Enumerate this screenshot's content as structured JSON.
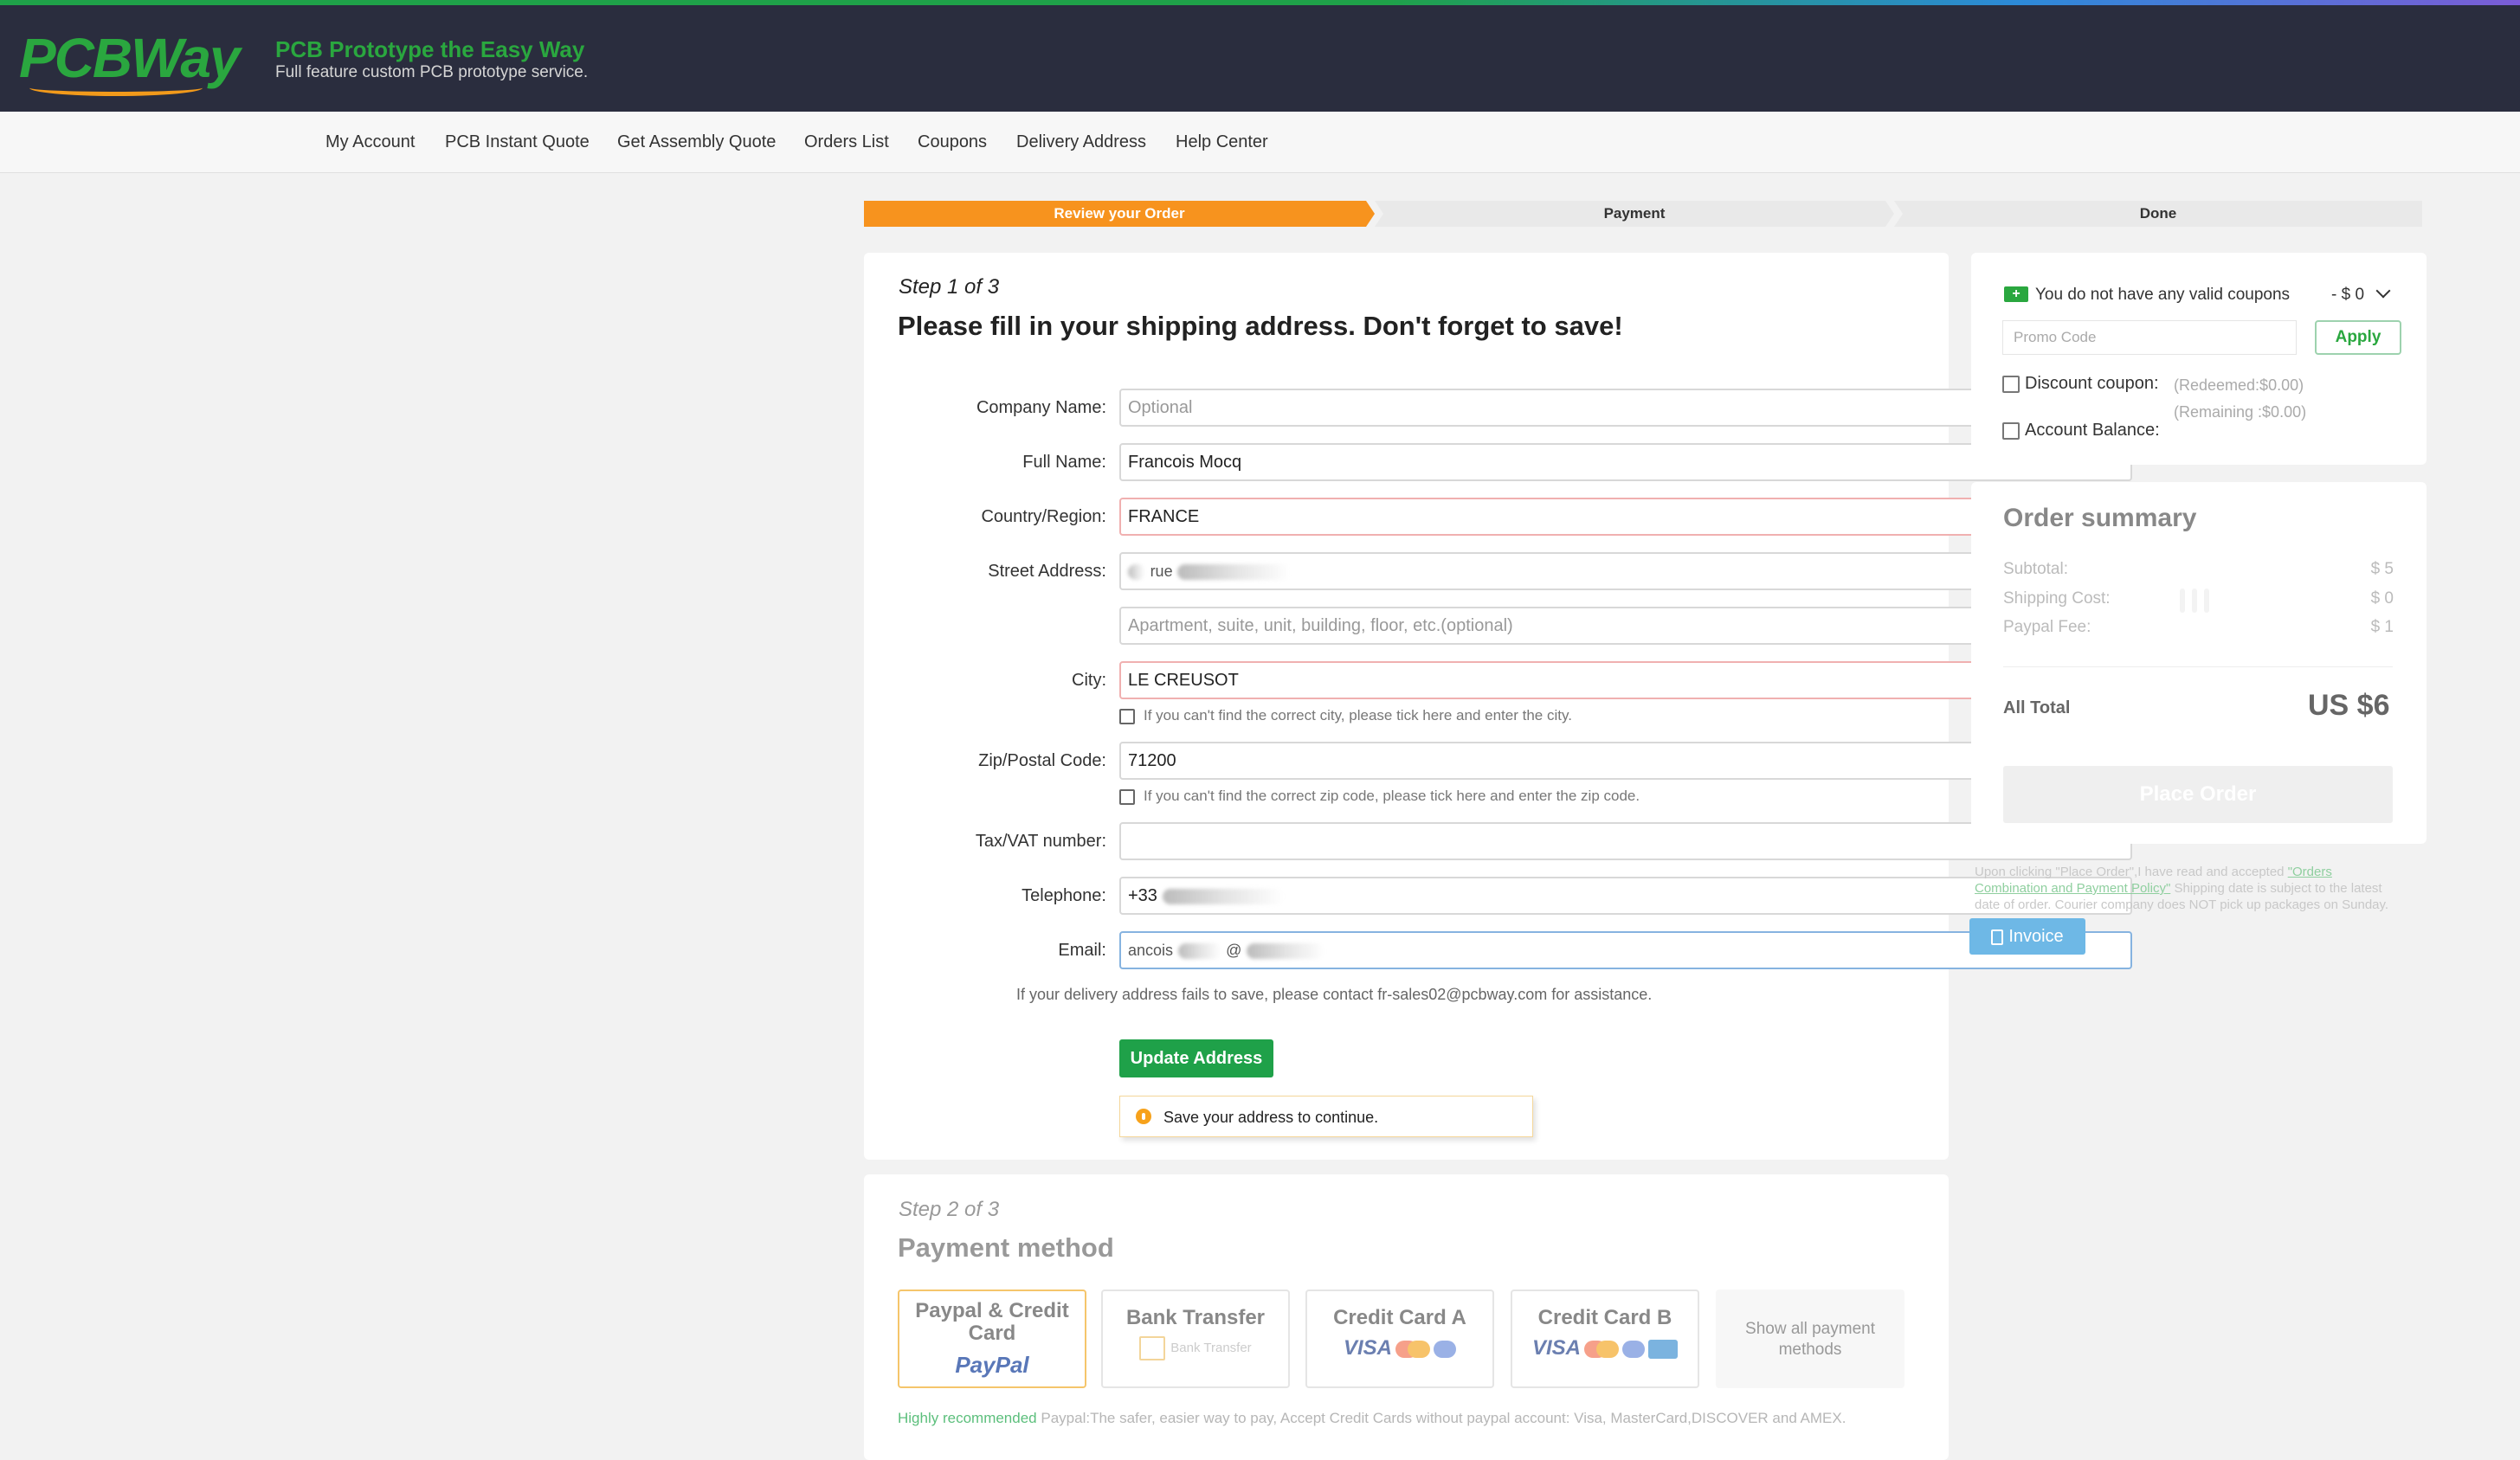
{
  "header": {
    "logo_text": "PCBWay",
    "tagline_title": "PCB Prototype the Easy Way",
    "tagline_sub": "Full feature custom PCB prototype service."
  },
  "nav": {
    "items": [
      "My Account",
      "PCB Instant Quote",
      "Get Assembly Quote",
      "Orders List",
      "Coupons",
      "Delivery Address",
      "Help Center"
    ]
  },
  "progress": {
    "steps": [
      "Review your Order",
      "Payment",
      "Done"
    ],
    "active": "Review your Order"
  },
  "step1": {
    "step_label": "Step 1 of 3",
    "title": "Please fill in your shipping address. Don't forget to save!",
    "labels": {
      "company": "Company Name:",
      "full_name": "Full Name:",
      "country": "Country/Region:",
      "street": "Street Address:",
      "city": "City:",
      "zip": "Zip/Postal Code:",
      "tax": "Tax/VAT number:",
      "telephone": "Telephone:",
      "email": "Email:"
    },
    "values": {
      "company_placeholder": "Optional",
      "full_name": "Francois Mocq",
      "country": "FRANCE",
      "street_visible": "rue",
      "street2_placeholder": "Apartment, suite, unit, building, floor, etc.(optional)",
      "city": "LE CREUSOT",
      "zip": "71200",
      "tax": "",
      "telephone_prefix": "+33",
      "email_visible_a": "ancois",
      "email_visible_b": "@"
    },
    "city_check": "If you can't find the correct city, please tick here and enter the city.",
    "zip_check": "If you can't find the correct zip code, please tick here and enter the zip code.",
    "assist_note": "If your delivery address fails to save, please contact fr-sales02@pcbway.com for assistance.",
    "update_button": "Update Address",
    "tooltip": "Save your address to continue."
  },
  "step2": {
    "step_label": "Step 2 of 3",
    "title": "Payment method",
    "options": [
      {
        "name": "Paypal & Credit Card",
        "logo": "PayPal"
      },
      {
        "name": "Bank Transfer",
        "logo": "Bank Transfer"
      },
      {
        "name": "Credit Card A",
        "logo": "VISA"
      },
      {
        "name": "Credit Card B",
        "logo": "VISA"
      }
    ],
    "show_all": "Show all payment methods",
    "recommend_highlight": "Highly recommended",
    "recommend_text": "Paypal:The safer, easier way to pay, Accept Credit Cards without paypal account: Visa, MasterCard,DISCOVER and AMEX."
  },
  "coupon": {
    "text": "You do not have any valid coupons",
    "value": "- $ 0",
    "promo_placeholder": "Promo Code",
    "apply": "Apply",
    "discount_label": "Discount coupon:",
    "redeemed": "(Redeemed:$0.00)",
    "remaining": "(Remaining :$0.00)",
    "balance_label": "Account Balance:"
  },
  "summary": {
    "title": "Order summary",
    "rows": [
      {
        "label": "Subtotal:",
        "value": "$ 5"
      },
      {
        "label": "Shipping Cost:",
        "value": "$ 0"
      },
      {
        "label": "Paypal Fee:",
        "value": "$ 1"
      }
    ],
    "total_label": "All Total",
    "total_value": "US $6",
    "place_order": "Place Order",
    "fine_print_a": "Upon clicking \"Place Order\",I have read and accepted ",
    "fine_print_link": "\"Orders Combination and Payment Policy\"",
    "fine_print_b": " Shipping date is subject to the latest date of order. Courier company does NOT pick up packages on Sunday.",
    "invoice": "Invoice"
  },
  "colors": {
    "brand_green": "#1fa149",
    "accent_orange": "#f7931e",
    "header_bg": "#2a2d3e"
  }
}
